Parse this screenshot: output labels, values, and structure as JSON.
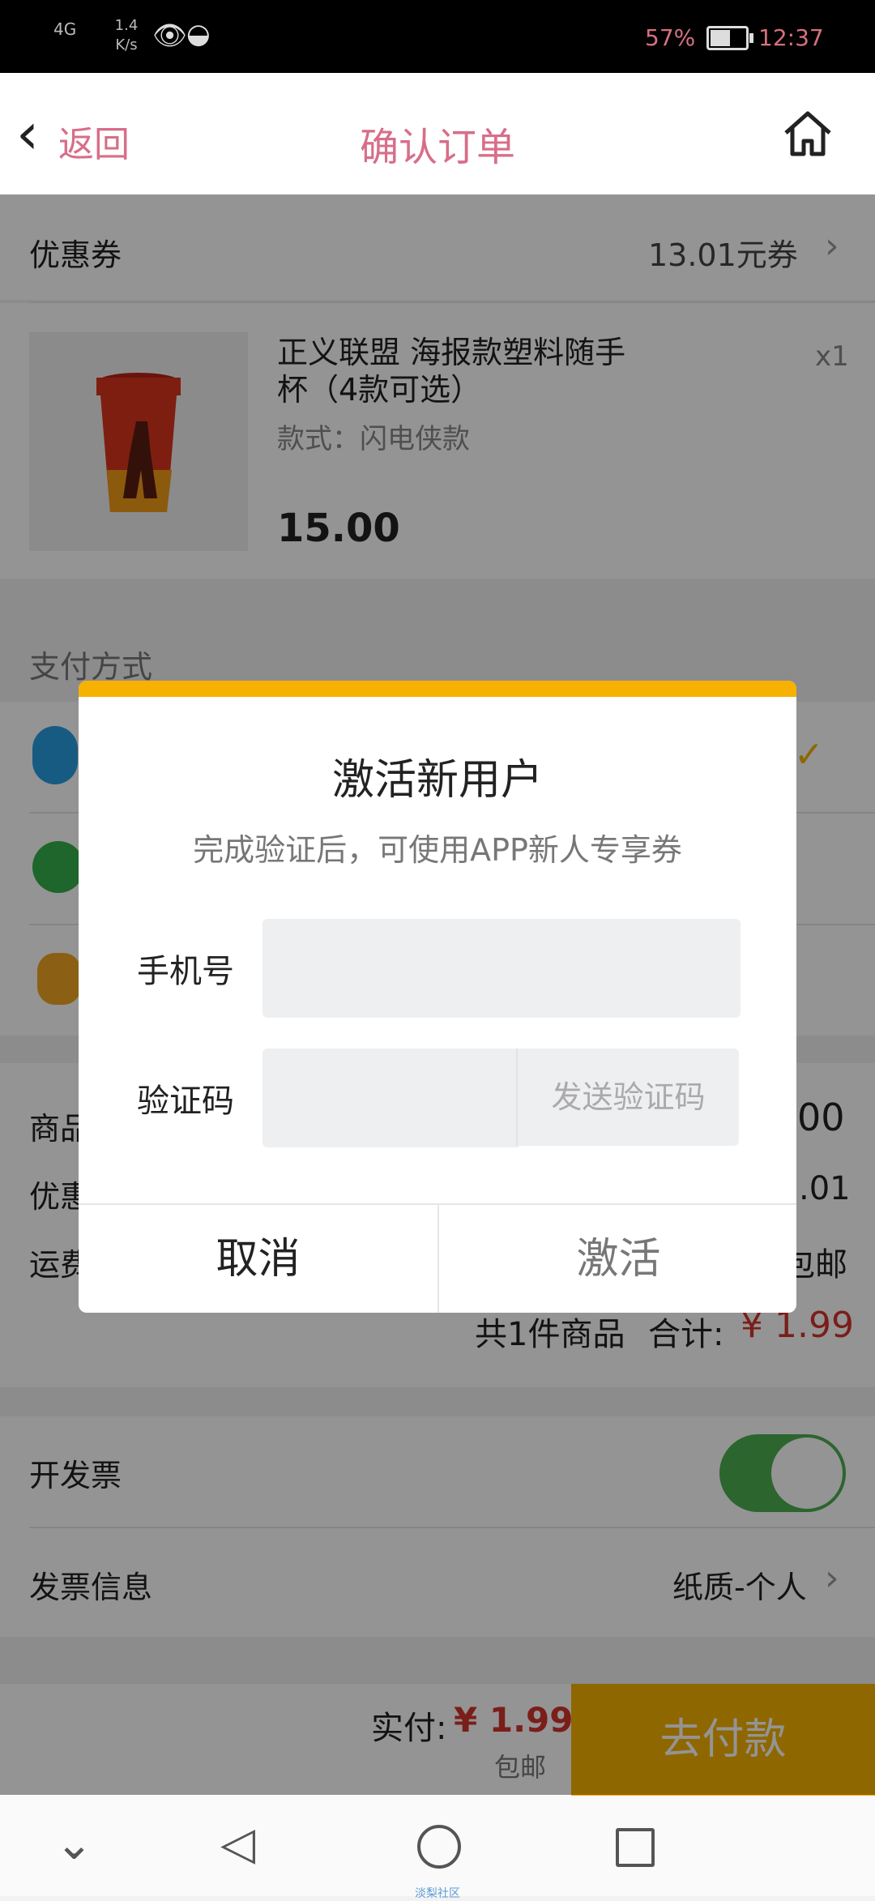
{
  "status_bar": {
    "network": "4G",
    "speed_value": "1.4",
    "speed_unit": "K/s",
    "battery": "57%",
    "time": "12:37"
  },
  "header": {
    "back_label": "返回",
    "title": "确认订单",
    "home_icon": "home-icon"
  },
  "coupon": {
    "label": "优惠券",
    "value": "13.01元券"
  },
  "product": {
    "title": "正义联盟 海报款塑料随手杯（4款可选）",
    "variant": "款式：闪电侠款",
    "price": "15.00",
    "qty": "x1"
  },
  "payment": {
    "section_title": "支付方式"
  },
  "summary": {
    "rows": [
      {
        "label": "商品",
        "value": "00"
      },
      {
        "label": "优惠",
        "value": ".01"
      },
      {
        "label": "运费",
        "value": "包邮"
      }
    ],
    "total_prefix": "共1件商品",
    "total_label": "合计:",
    "total_value": "¥ 1.99"
  },
  "invoice": {
    "toggle_label": "开发票",
    "toggle_on": true,
    "info_label": "发票信息",
    "info_value": "纸质-个人"
  },
  "pay_bar": {
    "real_label": "实付:",
    "real_value": "¥ 1.99",
    "shipping": "包邮",
    "pay_button": "去付款"
  },
  "dialog": {
    "title": "激活新用户",
    "subtitle": "完成验证后，可使用APP新人专享券",
    "phone_label": "手机号",
    "phone_value": "",
    "code_label": "验证码",
    "code_value": "",
    "send_code": "发送验证码",
    "cancel": "取消",
    "activate": "激活",
    "accent_color": "#f7b100"
  },
  "nav": {
    "watermark": "淡梨社区"
  },
  "colors": {
    "accent": "#f7b100",
    "price_red": "#d2352e",
    "header_title": "#d76e8a",
    "toggle_green": "#4caf50"
  }
}
